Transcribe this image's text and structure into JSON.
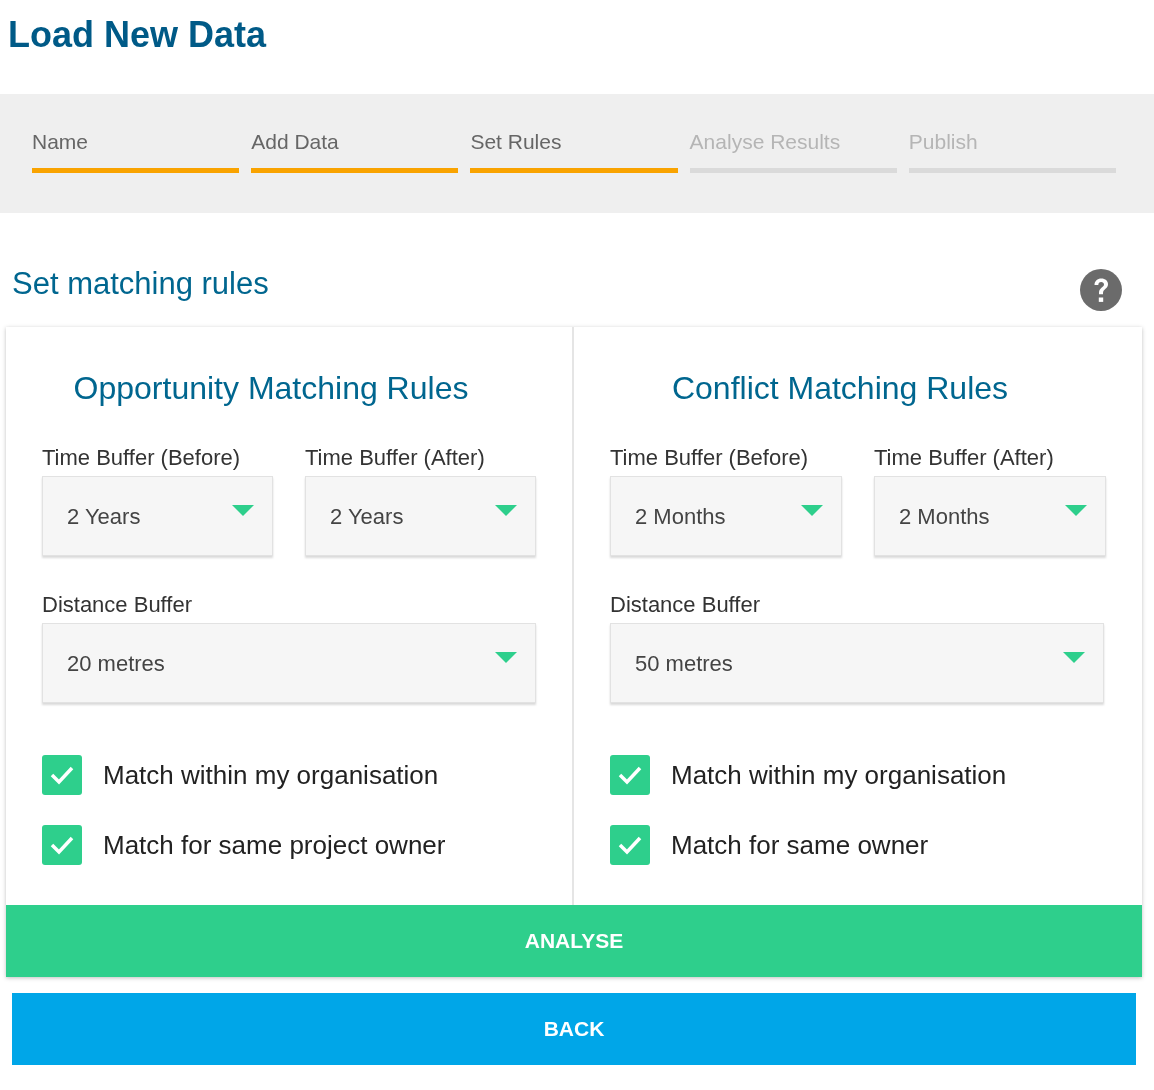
{
  "page_title": "Load New Data",
  "steps": [
    {
      "label": "Name",
      "completed": true
    },
    {
      "label": "Add Data",
      "completed": true
    },
    {
      "label": "Set Rules",
      "completed": true
    },
    {
      "label": "Analyse Results",
      "completed": false
    },
    {
      "label": "Publish",
      "completed": false
    }
  ],
  "section_title": "Set matching rules",
  "panels": [
    {
      "title": "Opportunity Matching Rules",
      "time_before": {
        "label": "Time Buffer (Before)",
        "value": "2 Years"
      },
      "time_after": {
        "label": "Time Buffer (After)",
        "value": "2 Years"
      },
      "distance": {
        "label": "Distance Buffer",
        "value": "20 metres"
      },
      "options": [
        {
          "label": "Match within my organisation",
          "checked": true
        },
        {
          "label": "Match for same project owner",
          "checked": true
        }
      ]
    },
    {
      "title": "Conflict Matching Rules",
      "time_before": {
        "label": "Time Buffer (Before)",
        "value": "2 Months"
      },
      "time_after": {
        "label": "Time Buffer (After)",
        "value": "2 Months"
      },
      "distance": {
        "label": "Distance Buffer",
        "value": "50 metres"
      },
      "options": [
        {
          "label": "Match within my organisation",
          "checked": true
        },
        {
          "label": "Match for same owner",
          "checked": true
        }
      ]
    }
  ],
  "analyse_button": "ANALYSE",
  "back_button": "BACK"
}
